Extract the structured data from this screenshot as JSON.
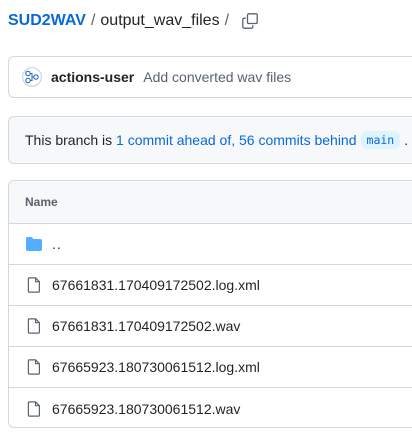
{
  "breadcrumb": {
    "repo": "SUD2WAV",
    "separator": "/",
    "folder": "output_wav_files",
    "trailing_separator": "/",
    "copy_icon": "copy-icon"
  },
  "commit": {
    "author": "actions-user",
    "message": "Add converted wav files",
    "avatar_icon": "actions-user-avatar"
  },
  "branch_status": {
    "prefix": "This branch is ",
    "ahead": "1 commit ahead of,",
    "space": " ",
    "behind": "56 commits behind",
    "branch": "main",
    "suffix": "."
  },
  "files": {
    "header": "Name",
    "parent": "..",
    "items": [
      {
        "name": "67661831.170409172502.log.xml",
        "icon": "file-icon"
      },
      {
        "name": "67661831.170409172502.wav",
        "icon": "file-icon"
      },
      {
        "name": "67665923.180730061512.log.xml",
        "icon": "file-icon"
      },
      {
        "name": "67665923.180730061512.wav",
        "icon": "file-icon"
      }
    ]
  },
  "colors": {
    "link": "#0969da",
    "folder": "#54aeff",
    "border": "#d1d9e0",
    "muted": "#59636e",
    "subtle_bg": "#f6f8fa"
  }
}
